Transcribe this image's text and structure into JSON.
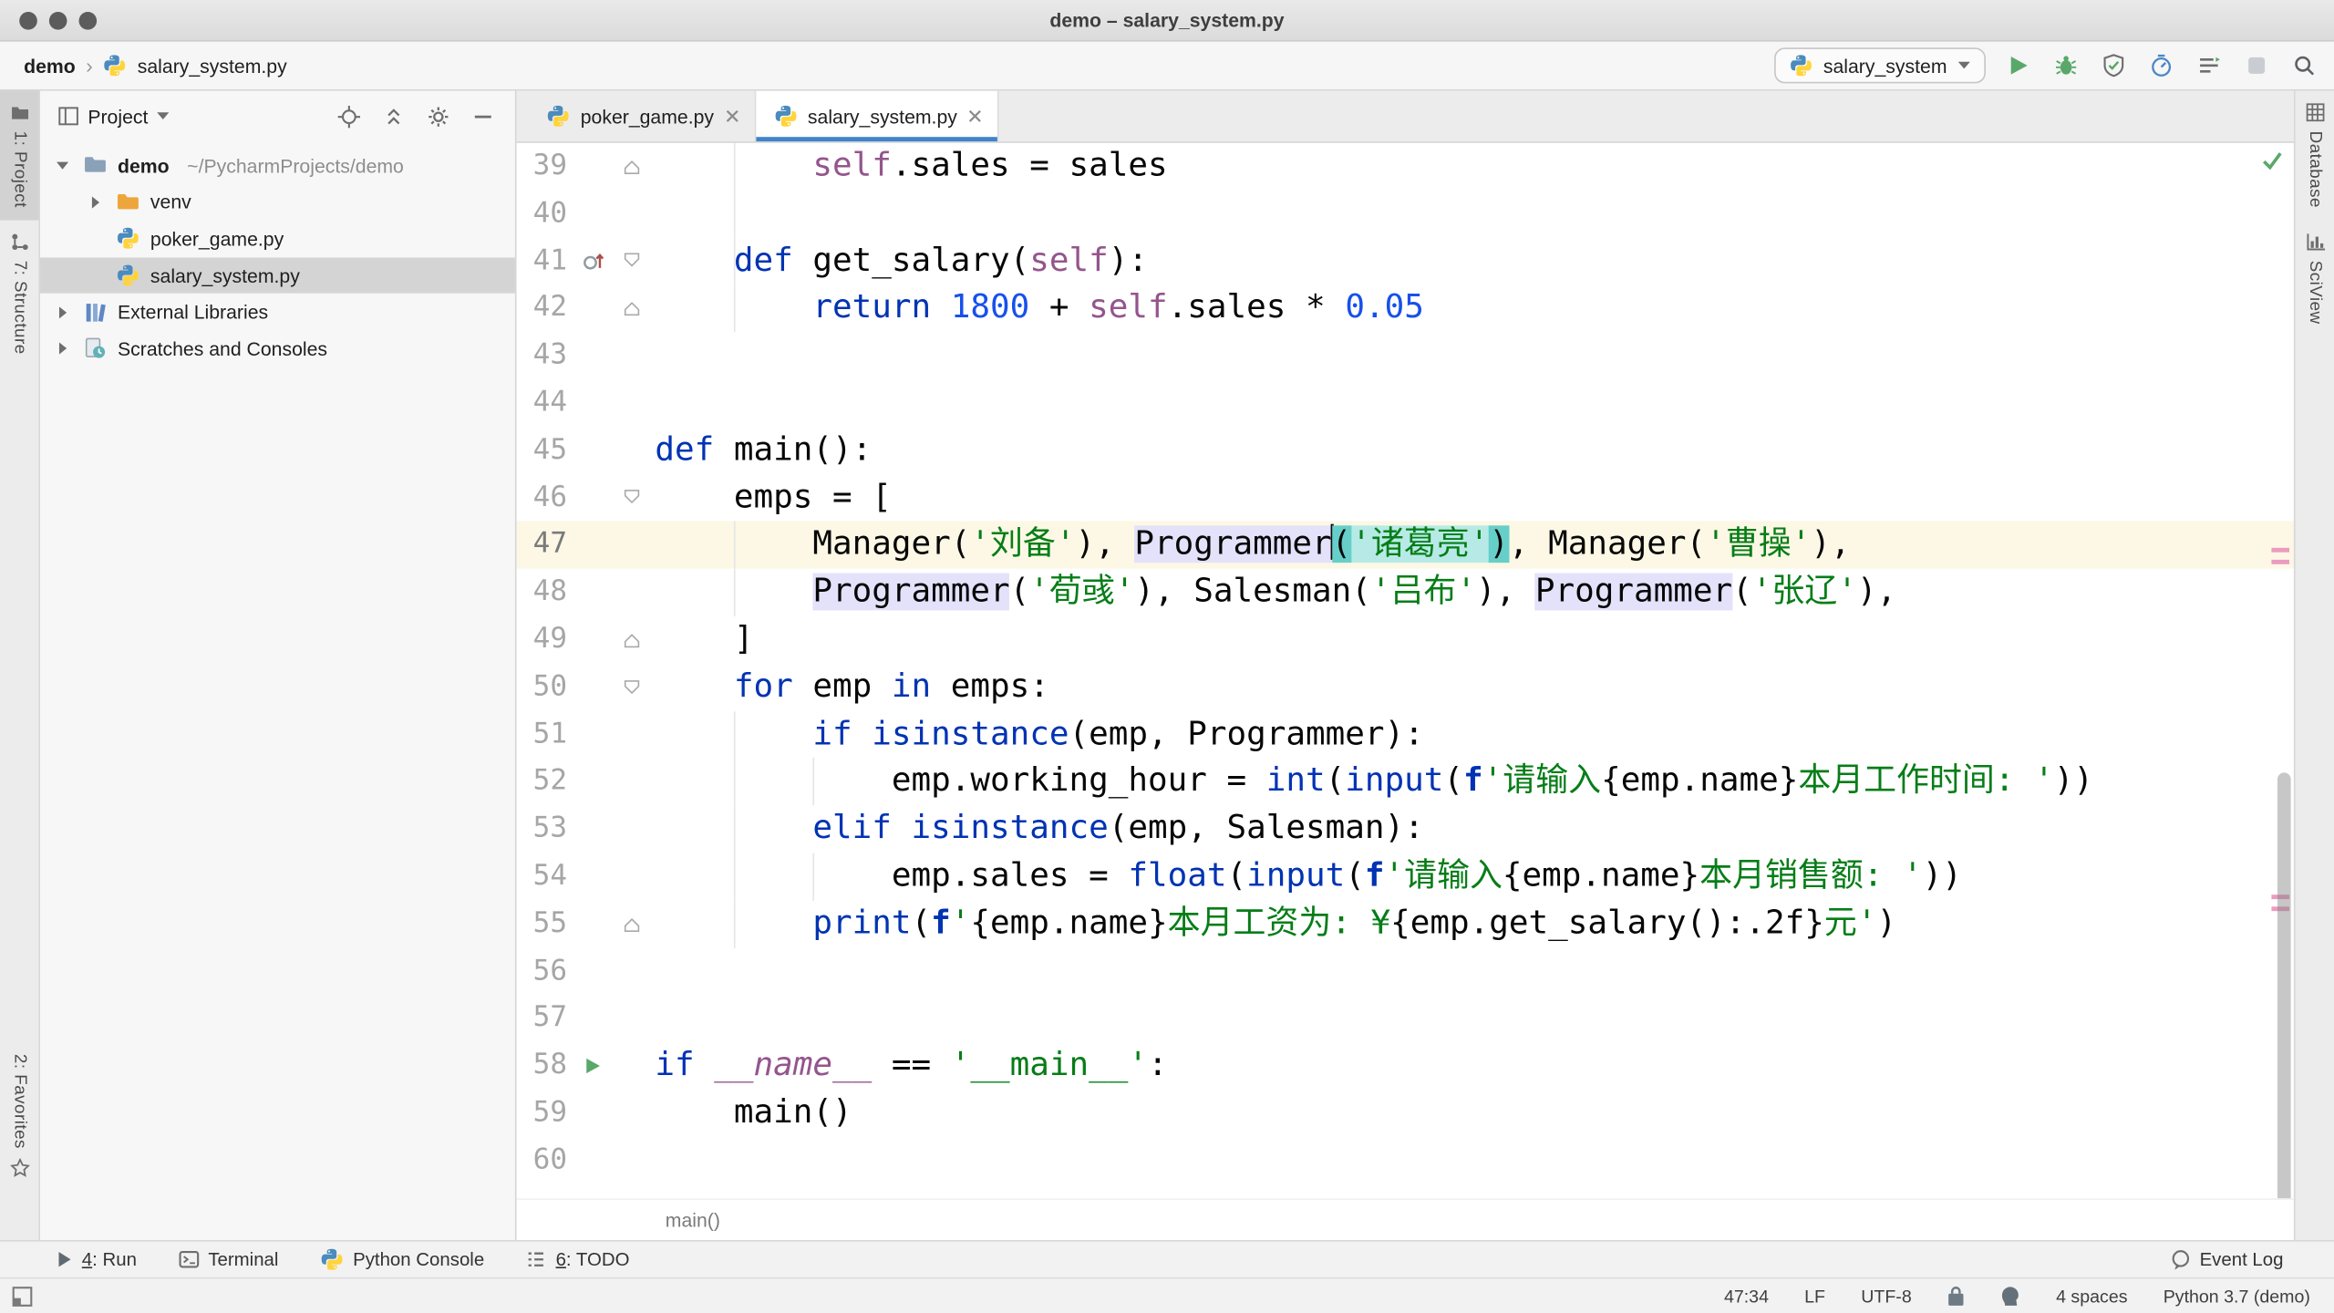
{
  "window": {
    "title": "demo – salary_system.py"
  },
  "navbar": {
    "breadcrumb": {
      "project": "demo",
      "separator": "›",
      "file": "salary_system.py",
      "file_icon": "python-file"
    },
    "run_config": {
      "label": "salary_system",
      "icon": "python-file",
      "caret_icon": "chevron-down"
    },
    "actions": [
      "run",
      "debug",
      "coverage",
      "profiler",
      "concurrency",
      "stop",
      "search"
    ]
  },
  "strips": {
    "left_top": [
      {
        "label": "1: Project",
        "icon": "project",
        "active": true
      },
      {
        "label": "7: Structure",
        "icon": "structure",
        "active": false
      }
    ],
    "left_bottom": [
      {
        "label": "2: Favorites",
        "icon": "star",
        "active": false
      }
    ],
    "right_top": [
      {
        "label": "Database",
        "icon": "database",
        "active": false
      },
      {
        "label": "SciView",
        "icon": "sciview",
        "active": false
      }
    ]
  },
  "project_panel": {
    "title": "Project",
    "icon": "project-pane",
    "caret_icon": "chevron-down",
    "header_icons": [
      "locate",
      "collapse-all",
      "settings",
      "hide"
    ],
    "tree": [
      {
        "label": "demo",
        "suffix": "~/PycharmProjects/demo",
        "icon": "folder",
        "arrow": "expanded",
        "bold": true,
        "depth": 0,
        "selected": false
      },
      {
        "label": "venv",
        "icon": "folder-excluded",
        "arrow": "collapsed",
        "depth": 1,
        "selected": false
      },
      {
        "label": "poker_game.py",
        "icon": "python-file",
        "arrow": "none",
        "depth": 1,
        "selected": false
      },
      {
        "label": "salary_system.py",
        "icon": "python-file",
        "arrow": "none",
        "depth": 1,
        "selected": true
      },
      {
        "label": "External Libraries",
        "icon": "libraries",
        "arrow": "collapsed",
        "depth": 0,
        "selected": false
      },
      {
        "label": "Scratches and Consoles",
        "icon": "scratches",
        "arrow": "collapsed",
        "depth": 0,
        "selected": false
      }
    ]
  },
  "editor": {
    "tabs": [
      {
        "label": "poker_game.py",
        "icon": "python-file",
        "active": false
      },
      {
        "label": "salary_system.py",
        "icon": "python-file",
        "active": true
      }
    ],
    "breadcrumb": "main()",
    "inspection_icon": "check",
    "stripe_marks": [
      307,
      315,
      540,
      548
    ],
    "lines": [
      {
        "n": 39,
        "fold": "up",
        "guides": [
          4
        ],
        "seg": [
          {
            "t": "        "
          },
          {
            "t": "self",
            "c": "self"
          },
          {
            "t": ".sales = sales"
          }
        ]
      },
      {
        "n": 40,
        "guides": [
          4
        ],
        "seg": []
      },
      {
        "n": 41,
        "icon": "override",
        "fold": "down",
        "guides": [
          4
        ],
        "seg": [
          {
            "t": "    "
          },
          {
            "t": "def",
            "c": "kw"
          },
          {
            "t": " get_salary("
          },
          {
            "t": "self",
            "c": "self"
          },
          {
            "t": "):"
          }
        ]
      },
      {
        "n": 42,
        "fold": "up",
        "guides": [
          4
        ],
        "seg": [
          {
            "t": "        "
          },
          {
            "t": "return",
            "c": "kw"
          },
          {
            "t": " "
          },
          {
            "t": "1800",
            "c": "num"
          },
          {
            "t": " + "
          },
          {
            "t": "self",
            "c": "self"
          },
          {
            "t": ".sales * "
          },
          {
            "t": "0.05",
            "c": "num"
          }
        ]
      },
      {
        "n": 43,
        "seg": []
      },
      {
        "n": 44,
        "seg": []
      },
      {
        "n": 45,
        "seg": [
          {
            "t": "def",
            "c": "kw"
          },
          {
            "t": " main():"
          }
        ]
      },
      {
        "n": 46,
        "fold": "down",
        "seg": [
          {
            "t": "    emps = ["
          }
        ]
      },
      {
        "n": 47,
        "current": true,
        "guides": [
          4
        ],
        "seg": [
          {
            "t": "        Manager("
          },
          {
            "t": "'刘备'",
            "c": "str"
          },
          {
            "t": "), "
          },
          {
            "t": "Programmer",
            "hl": "usage"
          },
          {
            "caret": true
          },
          {
            "t": "(",
            "hl": "brace"
          },
          {
            "t": "'诸葛亮'",
            "c": "str",
            "hl": "sel"
          },
          {
            "t": ")",
            "hl": "brace"
          },
          {
            "t": ", Manager("
          },
          {
            "t": "'曹操'",
            "c": "str"
          },
          {
            "t": "),"
          }
        ]
      },
      {
        "n": 48,
        "guides": [
          4
        ],
        "seg": [
          {
            "t": "        "
          },
          {
            "t": "Programmer",
            "hl": "usage"
          },
          {
            "t": "("
          },
          {
            "t": "'荀彧'",
            "c": "str"
          },
          {
            "t": "), Salesman("
          },
          {
            "t": "'吕布'",
            "c": "str"
          },
          {
            "t": "), "
          },
          {
            "t": "Programmer",
            "hl": "usage"
          },
          {
            "t": "("
          },
          {
            "t": "'张辽'",
            "c": "str"
          },
          {
            "t": "),"
          }
        ]
      },
      {
        "n": 49,
        "fold": "up",
        "seg": [
          {
            "t": "    ]"
          }
        ]
      },
      {
        "n": 50,
        "f": null,
        "fold": "down",
        "seg": [
          {
            "t": "    "
          },
          {
            "t": "for",
            "c": "kw"
          },
          {
            "t": " emp "
          },
          {
            "t": "in",
            "c": "kw"
          },
          {
            "t": " emps:"
          }
        ]
      },
      {
        "n": 51,
        "guides": [
          4
        ],
        "seg": [
          {
            "t": "        "
          },
          {
            "t": "if",
            "c": "kw"
          },
          {
            "t": " "
          },
          {
            "t": "isinstance",
            "c": "kw"
          },
          {
            "t": "(emp, Programmer):"
          }
        ]
      },
      {
        "n": 52,
        "guides": [
          4,
          8
        ],
        "seg": [
          {
            "t": "            emp.working_hour = "
          },
          {
            "t": "int",
            "c": "kw"
          },
          {
            "t": "("
          },
          {
            "t": "input",
            "c": "kw"
          },
          {
            "t": "("
          },
          {
            "t": "f",
            "c": "fpre"
          },
          {
            "t": "'请输入",
            "c": "str"
          },
          {
            "t": "{emp.name}"
          },
          {
            "t": "本月工作时间: '",
            "c": "str"
          },
          {
            "t": "))"
          }
        ]
      },
      {
        "n": 53,
        "guides": [
          4
        ],
        "seg": [
          {
            "t": "        "
          },
          {
            "t": "elif",
            "c": "kw"
          },
          {
            "t": " "
          },
          {
            "t": "isinstance",
            "c": "kw"
          },
          {
            "t": "(emp, Salesman):"
          }
        ]
      },
      {
        "n": 54,
        "guides": [
          4,
          8
        ],
        "seg": [
          {
            "t": "            emp.sales = "
          },
          {
            "t": "float",
            "c": "kw"
          },
          {
            "t": "("
          },
          {
            "t": "input",
            "c": "kw"
          },
          {
            "t": "("
          },
          {
            "t": "f",
            "c": "fpre"
          },
          {
            "t": "'请输入",
            "c": "str"
          },
          {
            "t": "{emp.name}"
          },
          {
            "t": "本月销售额: '",
            "c": "str"
          },
          {
            "t": "))"
          }
        ]
      },
      {
        "n": 55,
        "fold": "up",
        "guides": [
          4
        ],
        "seg": [
          {
            "t": "        "
          },
          {
            "t": "print",
            "c": "kw"
          },
          {
            "t": "("
          },
          {
            "t": "f",
            "c": "fpre"
          },
          {
            "t": "'",
            "c": "str"
          },
          {
            "t": "{emp.name}"
          },
          {
            "t": "本月工资为: ¥",
            "c": "str"
          },
          {
            "t": "{emp.get_salary():.2f}"
          },
          {
            "t": "元'",
            "c": "str"
          },
          {
            "t": ")"
          }
        ]
      },
      {
        "n": 56,
        "seg": []
      },
      {
        "n": 57,
        "seg": []
      },
      {
        "n": 58,
        "icon": "run",
        "seg": [
          {
            "t": "if",
            "c": "kw"
          },
          {
            "t": " "
          },
          {
            "t": "__name__",
            "c": "dunder"
          },
          {
            "t": " == "
          },
          {
            "t": "'__main__'",
            "c": "str"
          },
          {
            "t": ":"
          }
        ]
      },
      {
        "n": 59,
        "seg": [
          {
            "t": "    main()"
          }
        ]
      },
      {
        "n": 60,
        "seg": []
      }
    ]
  },
  "bottom_bar": {
    "left": [
      {
        "label": "4: Run",
        "icon": "run-small",
        "mnemonic": "4"
      },
      {
        "label": "Terminal",
        "icon": "terminal"
      },
      {
        "label": "Python Console",
        "icon": "python-console"
      },
      {
        "label": "6: TODO",
        "icon": "todo",
        "mnemonic": "6"
      }
    ],
    "right": [
      {
        "label": "Event Log",
        "icon": "event-log"
      }
    ]
  },
  "status_bar": {
    "caret": "47:34",
    "line_sep": "LF",
    "encoding": "UTF-8",
    "indent": "4 spaces",
    "interpreter": "Python 3.7 (demo)",
    "lock_icon": "lock",
    "highlight_icon": "hector",
    "toolwindow_icon": "toggle"
  },
  "colors": {
    "accent_tab_underline": "#4083C9",
    "run_green": "#59A869",
    "keyword_blue": "#0033B3",
    "string_green": "#067D17",
    "number_blue": "#1750EB",
    "self_purple": "#94558D",
    "usage_highlight": "#E4E1FA",
    "brace_match_teal": "#66CFC9",
    "caret_line": "#FCF8E5",
    "selection_gray": "#D4D4D4"
  }
}
